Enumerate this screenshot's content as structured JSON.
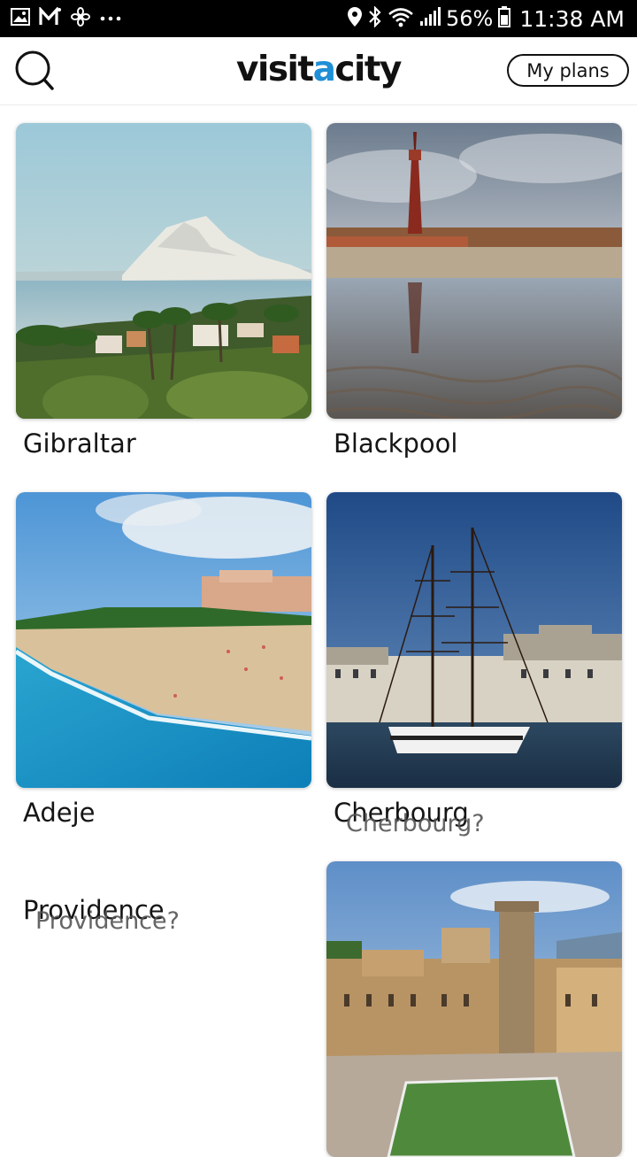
{
  "status_bar": {
    "icons_left": [
      "gallery-icon",
      "gmail-icon",
      "fan-icon",
      "more-icon"
    ],
    "icons_right": [
      "location-icon",
      "bluetooth-icon",
      "wifi-icon",
      "signal-icon",
      "battery-icon"
    ],
    "battery": "56%",
    "time": "11:38 AM"
  },
  "header": {
    "logo_part1": "visit",
    "logo_accent": "a",
    "logo_part2": "city",
    "my_plans_label": "My plans",
    "accent_color": "#1f8fd6"
  },
  "cities": [
    {
      "name": "Gibraltar"
    },
    {
      "name": "Blackpool"
    },
    {
      "name": "Adeje"
    },
    {
      "name": "Cherbourg",
      "ghost": "Cherbourg?"
    },
    {
      "name": "Providence",
      "ghost": "Providence?"
    },
    {
      "name": ""
    }
  ]
}
